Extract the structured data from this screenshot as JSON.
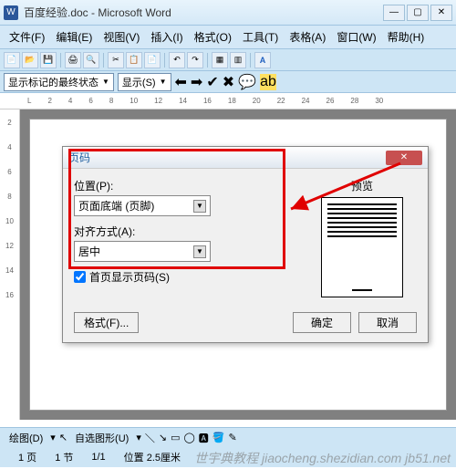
{
  "window": {
    "icon_text": "W",
    "title": "百度经验.doc - Microsoft Word",
    "btn_min": "—",
    "btn_max": "▢",
    "btn_close": "✕"
  },
  "menu": {
    "file": "文件(F)",
    "edit": "编辑(E)",
    "view": "视图(V)",
    "insert": "插入(I)",
    "format": "格式(O)",
    "tools": "工具(T)",
    "table": "表格(A)",
    "window": "窗口(W)",
    "help": "帮助(H)"
  },
  "toolbar2": {
    "track_combo": "显示标记的最终状态",
    "show_combo": "显示(S)"
  },
  "ruler_h": [
    "L",
    "2",
    "4",
    "6",
    "8",
    "10",
    "12",
    "14",
    "16",
    "18",
    "20",
    "22",
    "24",
    "26",
    "28",
    "30"
  ],
  "ruler_v": [
    "2",
    "4",
    "6",
    "8",
    "10",
    "12",
    "14",
    "16"
  ],
  "dialog": {
    "title": "页码",
    "close": "✕",
    "pos_label": "位置(P):",
    "pos_value": "页面底端 (页脚)",
    "align_label": "对齐方式(A):",
    "align_value": "居中",
    "first_page_label": "首页显示页码(S)",
    "first_page_checked": true,
    "preview_label": "预览",
    "format_btn": "格式(F)...",
    "ok_btn": "确定",
    "cancel_btn": "取消"
  },
  "drawbar": {
    "draw_label": "绘图(D)",
    "autoshape_label": "自选图形(U)"
  },
  "status": {
    "page": "1 页",
    "section": "1 节",
    "pages": "1/1",
    "position": "位置 2.5厘米"
  },
  "watermark": "世宇典教程\njiaocheng.shezidian.com  jb51.net"
}
